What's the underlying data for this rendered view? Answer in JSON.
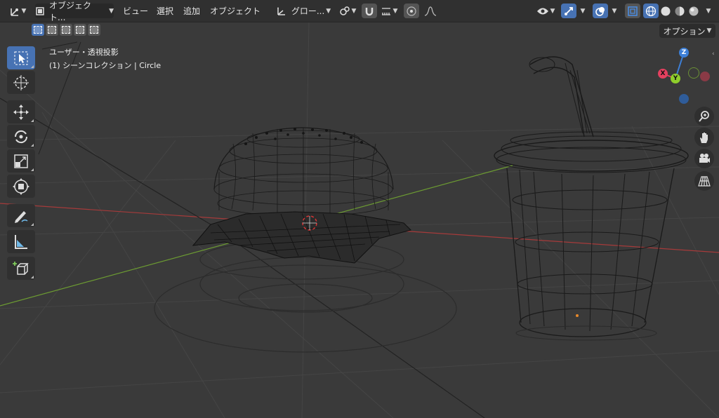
{
  "header": {
    "mode_label": "オブジェクト...",
    "menus": [
      "ビュー",
      "選択",
      "追加",
      "オブジェクト"
    ],
    "orientation_label": "グロー...",
    "options_label": "オプション"
  },
  "viewport": {
    "view_name": "ユーザー・透視投影",
    "collection_info": "(1) シーンコレクション | Circle"
  },
  "gizmo": {
    "z_label": "Z",
    "x_label": "X",
    "y_label": "Y",
    "colors": {
      "x": "#e4405f",
      "y": "#8fce2b",
      "z": "#3d7fd6"
    }
  },
  "toolbar": {
    "tools": [
      "select-box",
      "cursor",
      "move",
      "rotate",
      "scale",
      "transform",
      "annotate",
      "measure",
      "add-cube"
    ]
  },
  "theme": {
    "accent": "#4772b3",
    "x_axis_line": "#a63a3a",
    "y_axis_line": "#6c9b32"
  }
}
